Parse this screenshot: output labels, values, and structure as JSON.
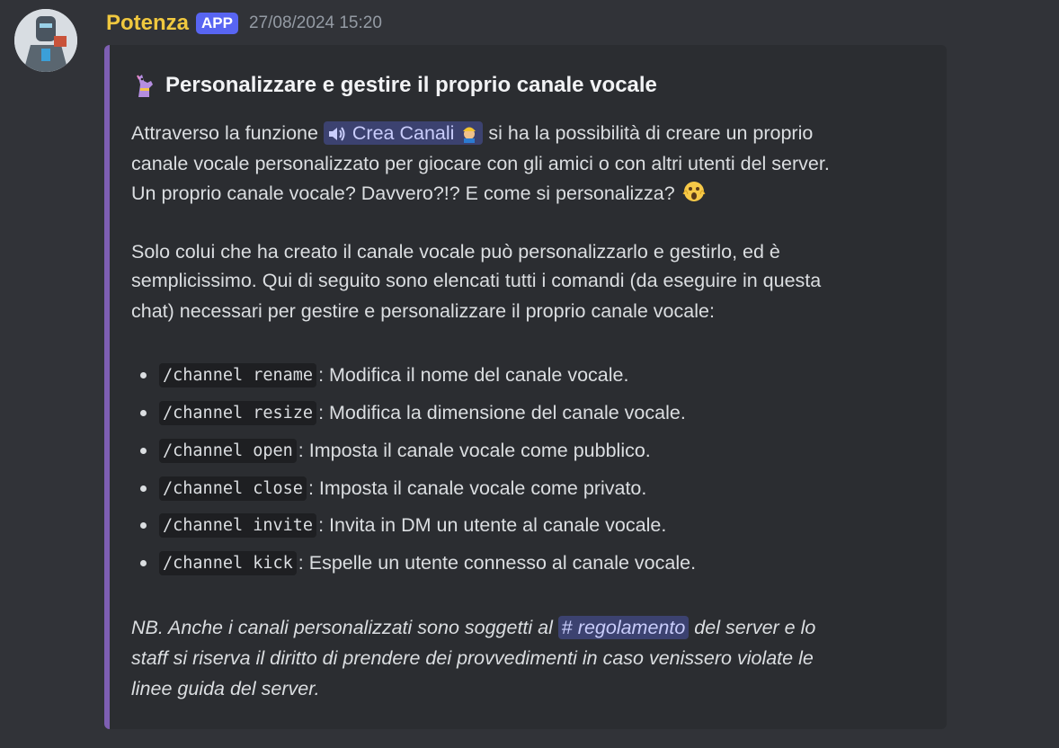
{
  "message": {
    "username": "Potenza",
    "badge": "APP",
    "timestamp": "27/08/2024 15:20",
    "avatar_icon": "robot-avatar-icon"
  },
  "embed": {
    "accent_color": "#7e5fb3",
    "title_emoji": "llama-icon",
    "title": "Personalizzare e gestire il proprio canale vocale",
    "p1_a": "Attraverso la funzione ",
    "p1_mention": "Crea Canali",
    "p1_b": " si ha la possibilità di creare un proprio",
    "p1_line2": "canale vocale personalizzato per giocare con gli amici o con altri utenti del server.",
    "p1_line3": "Un proprio canale vocale? Davvero?!? E come si personalizza?",
    "p2_line1": "Solo colui che ha creato il canale vocale può personalizzarlo e gestirlo, ed è",
    "p2_line2": "semplicissimo. Qui di seguito sono elencati tutti i comandi (da eseguire in questa",
    "p2_line3": "chat) necessari per gestire e personalizzare il proprio canale vocale:",
    "commands": [
      {
        "code": "/channel rename",
        "desc": ": Modifica il nome del canale vocale."
      },
      {
        "code": "/channel resize",
        "desc": ": Modifica la dimensione del canale vocale."
      },
      {
        "code": "/channel open",
        "desc": ": Imposta il canale vocale come pubblico."
      },
      {
        "code": "/channel close",
        "desc": ": Imposta il canale vocale come privato."
      },
      {
        "code": "/channel invite",
        "desc": ": Invita in DM un utente al canale vocale."
      },
      {
        "code": "/channel kick",
        "desc": ": Espelle un utente connesso al canale vocale."
      }
    ],
    "nb_a": "NB. Anche i canali personalizzati sono soggetti al ",
    "nb_mention": "regolamento",
    "nb_b": " del server e lo",
    "nb_line2": "staff si riserva il diritto di prendere dei provvedimenti in caso venissero violate le",
    "nb_line3": "linee guida del server."
  }
}
